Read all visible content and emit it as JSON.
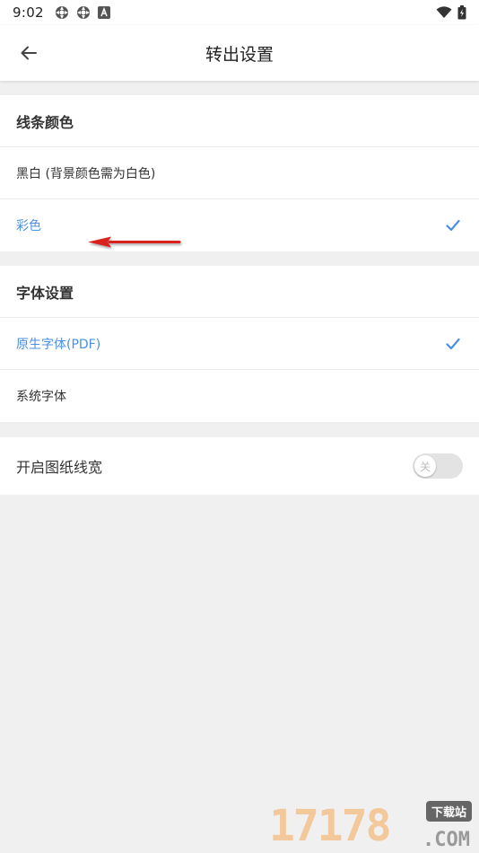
{
  "status_bar": {
    "time": "9:02",
    "left_icons": [
      "sync-icon",
      "sync-icon",
      "app-a-icon"
    ],
    "right_icons": [
      "wifi-icon",
      "battery-icon"
    ]
  },
  "app_bar": {
    "title": "转出设置",
    "back_icon": "arrow-left-icon"
  },
  "line_color": {
    "header": "线条颜色",
    "options": [
      {
        "label": "黑白 (背景颜色需为白色)",
        "selected": false
      },
      {
        "label": "彩色",
        "selected": true
      }
    ]
  },
  "font_settings": {
    "header": "字体设置",
    "options": [
      {
        "label": "原生字体(PDF)",
        "selected": true
      },
      {
        "label": "系统字体",
        "selected": false
      }
    ]
  },
  "line_width": {
    "label": "开启图纸线宽",
    "toggle_state": "关",
    "enabled": false
  },
  "watermark": {
    "number": "17178",
    "badge": "下载站",
    "domain": ".COM"
  },
  "colors": {
    "accent": "#4a90e2",
    "annotation_arrow": "#d9201e",
    "background": "#f0f0f0"
  }
}
